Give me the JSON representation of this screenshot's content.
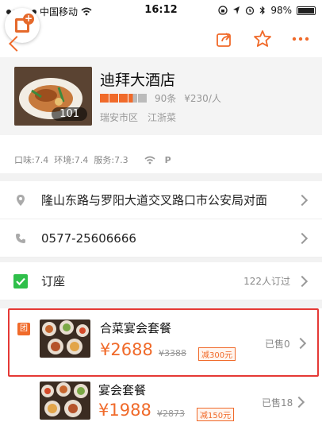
{
  "status": {
    "carrier": "中国移动",
    "time": "16:12",
    "battery": "98%",
    "battery_level": 0.98
  },
  "shop": {
    "name": "迪拜大酒店",
    "photo_count": "101",
    "rating_stars": 3.5,
    "reviews": "90条",
    "price": "¥230/人",
    "district": "瑞安市区",
    "cuisine": "江浙菜"
  },
  "scores": {
    "text": "口味:7.4  环境:7.4  服务:7.3",
    "parking": "P"
  },
  "address": "隆山东路与罗阳大道交叉路口市公安局对面",
  "phone": "0577-25606666",
  "booking": {
    "label": "订座",
    "count": "122人订过"
  },
  "deals": [
    {
      "badge": "团",
      "title": "合菜宴会套餐",
      "price": "¥2688",
      "original": "¥3388",
      "discount": "减300元",
      "sold": "已售0"
    },
    {
      "title": "宴会套餐",
      "price": "¥1988",
      "original": "¥2873",
      "discount": "减150元",
      "sold": "已售18"
    }
  ],
  "colors": {
    "accent": "#f06a2a",
    "highlight_border": "#e53935",
    "check_green": "#2fbf4a"
  }
}
